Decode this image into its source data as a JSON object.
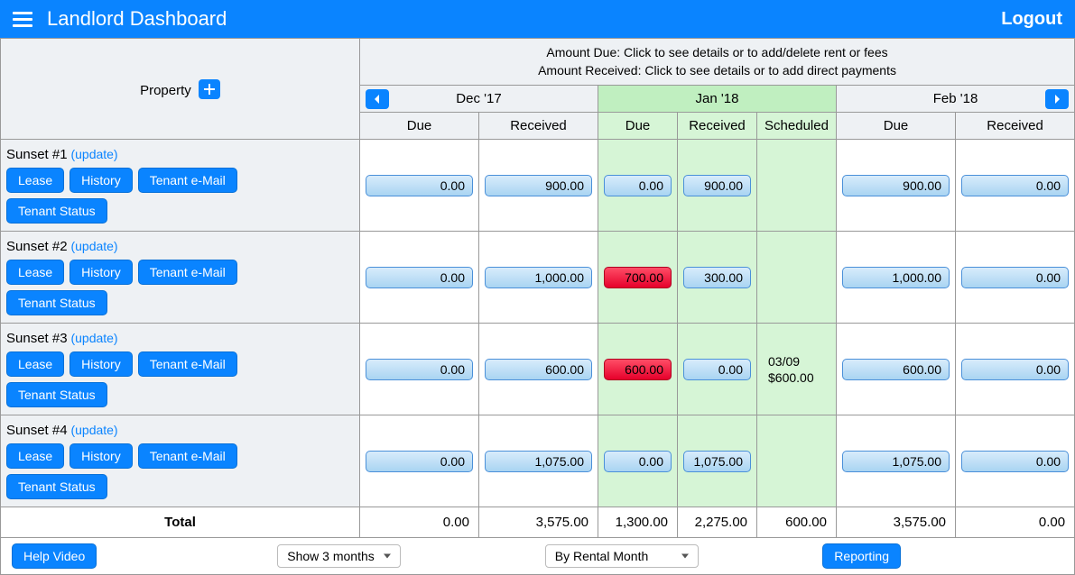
{
  "header": {
    "title": "Landlord Dashboard",
    "logout": "Logout"
  },
  "instructions": {
    "line1": "Amount Due: Click to see details or to add/delete rent or fees",
    "line2": "Amount Received: Click to see details or to add direct payments"
  },
  "propertyHeader": "Property",
  "months": {
    "prev": "Dec '17",
    "cur": "Jan '18",
    "next": "Feb '18"
  },
  "subHeaders": {
    "due": "Due",
    "received": "Received",
    "scheduled": "Scheduled"
  },
  "updateLabel": "(update)",
  "buttons": {
    "lease": "Lease",
    "history": "History",
    "email": "Tenant e-Mail",
    "status": "Tenant Status",
    "help": "Help Video",
    "reporting": "Reporting"
  },
  "selects": {
    "months": "Show 3 months",
    "view": "By Rental Month"
  },
  "properties": [
    {
      "name": "Sunset #1",
      "prevDue": "0.00",
      "prevRec": "900.00",
      "curDue": "0.00",
      "curRec": "900.00",
      "curDueAlert": false,
      "sched": "",
      "nextDue": "900.00",
      "nextRec": "0.00"
    },
    {
      "name": "Sunset #2",
      "prevDue": "0.00",
      "prevRec": "1,000.00",
      "curDue": "700.00",
      "curRec": "300.00",
      "curDueAlert": true,
      "sched": "",
      "nextDue": "1,000.00",
      "nextRec": "0.00"
    },
    {
      "name": "Sunset #3",
      "prevDue": "0.00",
      "prevRec": "600.00",
      "curDue": "600.00",
      "curRec": "0.00",
      "curDueAlert": true,
      "sched": "03/09\n$600.00",
      "nextDue": "600.00",
      "nextRec": "0.00"
    },
    {
      "name": "Sunset #4",
      "prevDue": "0.00",
      "prevRec": "1,075.00",
      "curDue": "0.00",
      "curRec": "1,075.00",
      "curDueAlert": false,
      "sched": "",
      "nextDue": "1,075.00",
      "nextRec": "0.00"
    }
  ],
  "totals": {
    "label": "Total",
    "prevDue": "0.00",
    "prevRec": "3,575.00",
    "curDue": "1,300.00",
    "curRec": "2,275.00",
    "curSched": "600.00",
    "nextDue": "3,575.00",
    "nextRec": "0.00"
  }
}
